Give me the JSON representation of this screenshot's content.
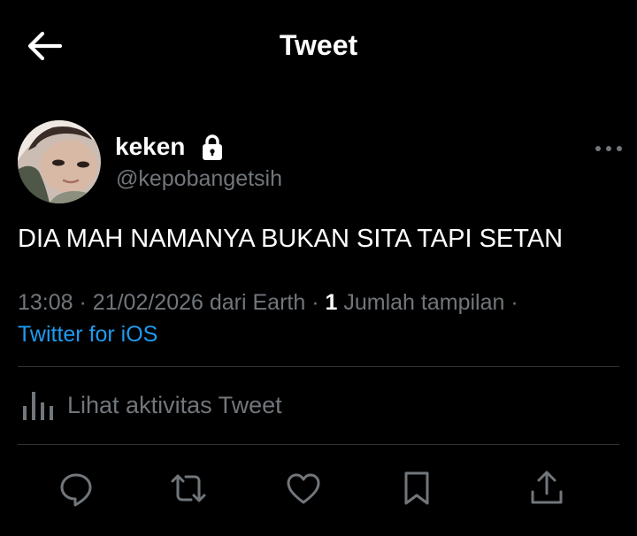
{
  "header": {
    "title": "Tweet"
  },
  "author": {
    "display_name": "keken",
    "handle": "@kepobangetsih"
  },
  "tweet": {
    "text": "DIA MAH NAMANYA BUKAN SITA TAPI SETAN",
    "time": "13:08",
    "date": "21/02/2026",
    "location_text": "dari Earth",
    "views_count": "1",
    "views_label": "Jumlah tampilan",
    "separator": "·",
    "source": "Twitter for iOS"
  },
  "activity": {
    "label": "Lihat aktivitas Tweet"
  },
  "actions": [
    "reply-icon",
    "retweet-icon",
    "like-icon",
    "bookmark-icon",
    "share-icon"
  ],
  "icons": {
    "back": "arrow-left-icon",
    "lock": "lock-icon",
    "more": "more-icon",
    "activity": "bar-chart-icon"
  },
  "colors": {
    "background": "#000000",
    "text": "#ffffff",
    "secondary": "#71767b",
    "link": "#1d9bf0",
    "divider": "#2f3336"
  }
}
